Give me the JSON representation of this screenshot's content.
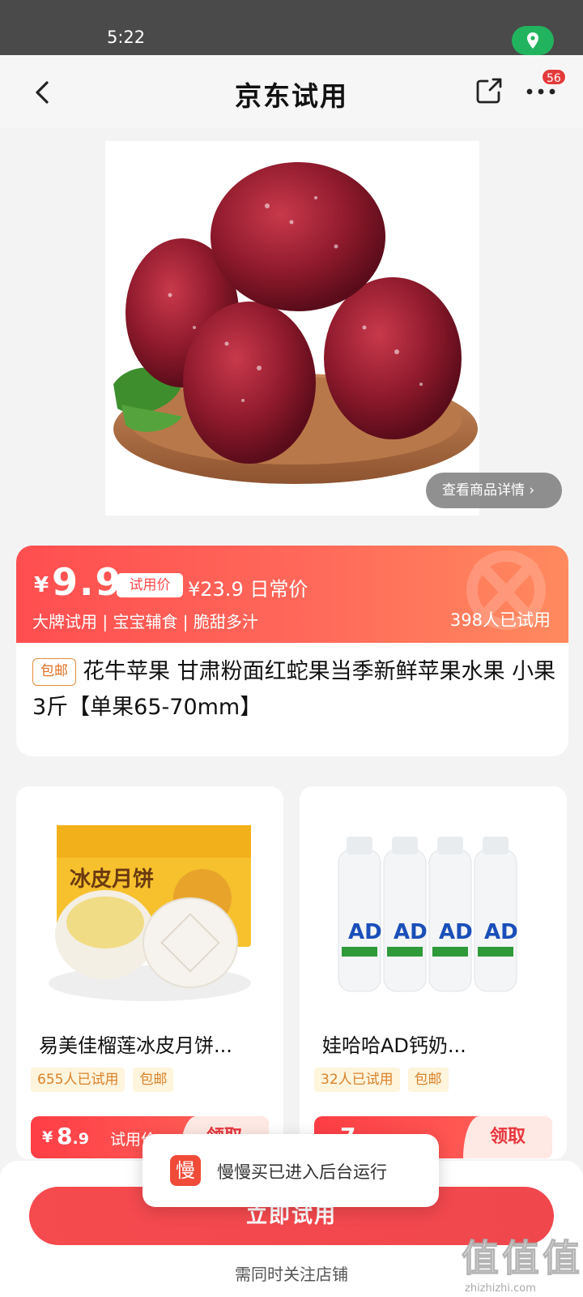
{
  "status_bar": {
    "time": "5:22"
  },
  "nav": {
    "title": "京东试用",
    "badge_count": "56"
  },
  "hero": {
    "detail_button": "查看商品详情"
  },
  "price_card": {
    "currency": "¥",
    "price": "9.9",
    "trial_price_tag": "试用价",
    "original_price": "¥23.9 日常价",
    "tags": "大牌试用 | 宝宝辅食 | 脆甜多汁",
    "trial_count": "398人已试用",
    "free_shipping": "包邮",
    "product_title": "花牛苹果 甘肃粉面红蛇果当季新鲜苹果水果 小果3斤【单果65-70mm】"
  },
  "recommendations": [
    {
      "name": "易美佳榴莲冰皮月饼...",
      "trial_count": "655人已试用",
      "shipping": "包邮",
      "currency": "¥",
      "price_int": "8",
      "price_dec": ".9",
      "price_label": "试用价",
      "action": "领取"
    },
    {
      "name": "娃哈哈AD钙奶...",
      "trial_count": "32人已试用",
      "shipping": "包邮",
      "currency": "",
      "price_int": "7",
      "price_dec": "",
      "price_label": "",
      "action": "领取"
    }
  ],
  "bottom": {
    "try_button": "立即试用",
    "follow_note": "需同时关注店铺"
  },
  "toast": {
    "app_icon_char": "慢",
    "message": "慢慢买已进入后台运行"
  },
  "watermark": {
    "big": "值值值",
    "small": "zhizhizhi.com"
  },
  "colors": {
    "accent": "#ff4e50",
    "status_green": "#22b35e",
    "badge_red": "#e33b3b"
  }
}
